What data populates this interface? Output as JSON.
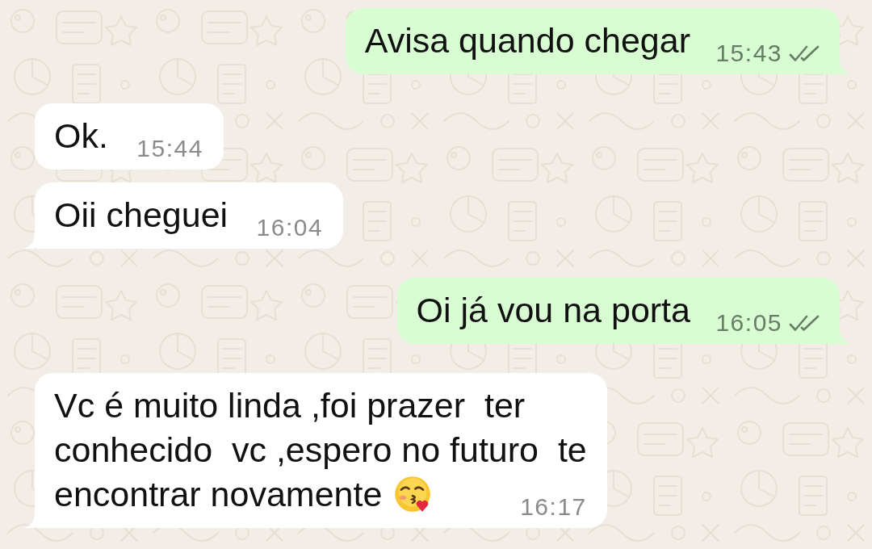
{
  "messages": [
    {
      "kind": "outgoing",
      "lines": [
        "Avisa quando chegar"
      ],
      "time": "15:43",
      "delivered": true,
      "read": false,
      "tail": true
    },
    {
      "kind": "incoming",
      "lines": [
        "Ok."
      ],
      "time": "15:44",
      "tail": false
    },
    {
      "kind": "incoming",
      "lines": [
        "Oii cheguei"
      ],
      "time": "16:04",
      "tail": true
    },
    {
      "kind": "outgoing",
      "lines": [
        "Oi já vou na porta"
      ],
      "time": "16:05",
      "delivered": true,
      "read": false,
      "tail": true
    },
    {
      "kind": "incoming",
      "lines": [
        "Vc é muito linda ,foi prazer  ter",
        "conhecido  vc ,espero no futuro  te",
        "encontrar novamente"
      ],
      "emoji": true,
      "time": "16:17",
      "tail": true
    }
  ]
}
